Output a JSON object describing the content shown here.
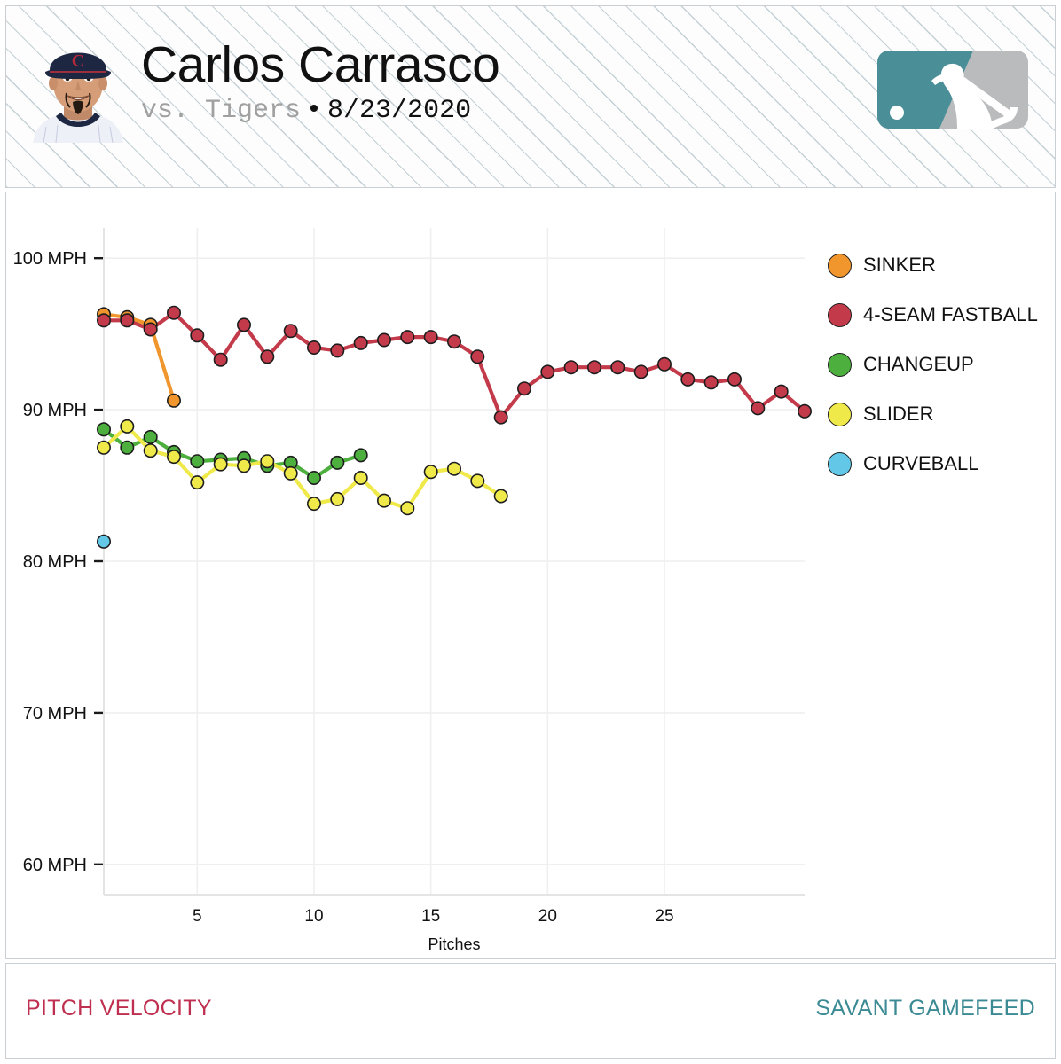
{
  "header": {
    "player_name": "Carlos Carrasco",
    "vs_text": "vs. Tigers",
    "separator": "•",
    "date": "8/23/2020",
    "logo_name": "mlb-logo",
    "logo_colors": {
      "teal": "#4a8f98",
      "gray": "#b9bbbd"
    },
    "headshot_name": "player-headshot"
  },
  "legend": {
    "items": [
      {
        "label": "SINKER",
        "color": "#f0962d"
      },
      {
        "label": "4-SEAM FASTBALL",
        "color": "#c33b4b"
      },
      {
        "label": "CHANGEUP",
        "color": "#4caf3e"
      },
      {
        "label": "SLIDER",
        "color": "#f0e94a"
      },
      {
        "label": "CURVEBALL",
        "color": "#63c8e8"
      }
    ]
  },
  "footer": {
    "left_label": "PITCH VELOCITY",
    "left_color": "#bf3050",
    "right_label": "SAVANT GAMEFEED",
    "right_color": "#3b8a94"
  },
  "chart_data": {
    "type": "line",
    "title": "Pitch Velocity",
    "xlabel": "Pitches",
    "ylabel": "",
    "xlim": [
      1,
      31
    ],
    "ylim": [
      58,
      102
    ],
    "grid": true,
    "legend_position": "right",
    "ytick_labels": [
      "100 MPH",
      "90 MPH",
      "80 MPH",
      "70 MPH",
      "60 MPH"
    ],
    "ytick_values": [
      100,
      90,
      80,
      70,
      60
    ],
    "xtick_labels": [
      "5",
      "10",
      "15",
      "20",
      "25"
    ],
    "xtick_values": [
      5,
      10,
      15,
      20,
      25
    ],
    "series": [
      {
        "name": "SINKER",
        "color": "#f0962d",
        "x": [
          1,
          2,
          3,
          4
        ],
        "values": [
          96.3,
          96.1,
          95.6,
          90.6
        ]
      },
      {
        "name": "4-SEAM FASTBALL",
        "color": "#c33b4b",
        "x": [
          1,
          2,
          3,
          4,
          5,
          6,
          7,
          8,
          9,
          10,
          11,
          12,
          13,
          14,
          15,
          16,
          17,
          18,
          19,
          20,
          21,
          22,
          23,
          24,
          25,
          26,
          27,
          28,
          29,
          30
        ],
        "values": [
          95.9,
          95.9,
          95.3,
          96.4,
          94.9,
          93.3,
          95.6,
          93.5,
          95.2,
          94.1,
          93.9,
          94.4,
          94.6,
          94.8,
          94.8,
          94.5,
          93.5,
          89.5,
          91.4,
          92.5,
          92.8,
          92.8,
          92.8,
          92.5,
          93.0,
          92.0,
          91.8,
          92.0,
          90.1,
          91.2
        ]
      },
      {
        "name": "4-SEAM FASTBALL (tail)",
        "color": "#c33b4b",
        "x": [
          31
        ],
        "values": [
          89.9
        ],
        "connect_from": 30
      },
      {
        "name": "CHANGEUP",
        "color": "#4caf3e",
        "x": [
          1,
          2,
          3,
          4,
          5,
          6,
          7,
          8,
          9,
          10,
          11,
          12
        ],
        "values": [
          88.7,
          87.5,
          88.2,
          87.2,
          86.6,
          86.7,
          86.8,
          86.3,
          86.5,
          85.5,
          86.5,
          87.0
        ]
      },
      {
        "name": "SLIDER",
        "color": "#f0e94a",
        "x": [
          1,
          2,
          3,
          4,
          5,
          6,
          7,
          8,
          9,
          10,
          11,
          12,
          13,
          14,
          15,
          16,
          17,
          18
        ],
        "values": [
          87.5,
          88.9,
          87.3,
          86.9,
          85.2,
          86.4,
          86.3,
          86.6,
          85.8,
          83.8,
          84.1,
          85.5,
          84.0,
          83.5,
          85.9,
          86.1,
          85.3,
          84.3
        ]
      },
      {
        "name": "CURVEBALL",
        "color": "#63c8e8",
        "x": [
          1
        ],
        "values": [
          81.3
        ]
      }
    ]
  }
}
